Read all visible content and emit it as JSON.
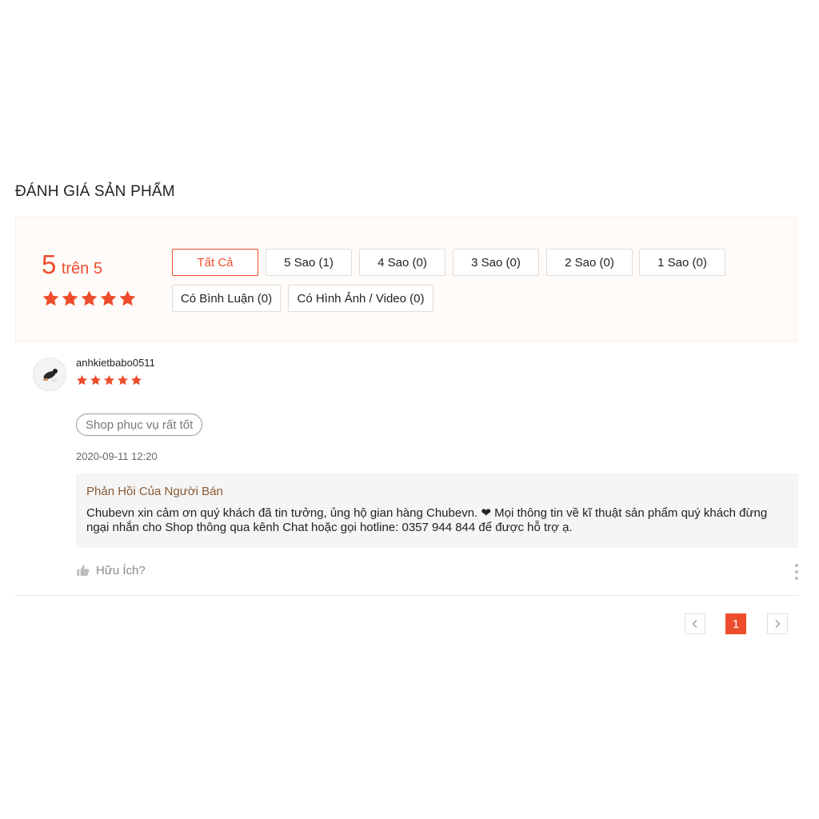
{
  "section": {
    "title": "ĐÁNH GIÁ SẢN PHẨM"
  },
  "overview": {
    "score": "5",
    "score_suffix": "trên 5",
    "stars": 5,
    "star_color": "#ee4d2d"
  },
  "filters": [
    {
      "label": "Tất Cả",
      "active": true
    },
    {
      "label": "5 Sao (1)",
      "active": false
    },
    {
      "label": "4 Sao (0)",
      "active": false
    },
    {
      "label": "3 Sao (0)",
      "active": false
    },
    {
      "label": "2 Sao (0)",
      "active": false
    },
    {
      "label": "1 Sao (0)",
      "active": false
    },
    {
      "label": "Có Bình Luận (0)",
      "active": false
    },
    {
      "label": "Có Hình Ảnh / Video (0)",
      "active": false
    }
  ],
  "review": {
    "username": "anhkietbabo0511",
    "rating": 5,
    "tag": "Shop phục vụ rất tốt",
    "timestamp": "2020-09-11 12:20",
    "seller_reply": {
      "title": "Phản Hồi Của Người Bán",
      "text_line1": "Chubevn xin cảm ơn quý khách đã tin tưởng, ủng hộ gian hàng Chubevn. ❤ Mọi thông tin về kĩ thuật sản phẩm quý khách đừng",
      "text_line2": "ngại nhắn cho Shop thông qua kênh Chat hoặc gọi hotline: 0357 944 844 để được hỗ trợ ạ."
    },
    "helpful_label": "Hữu Ích?"
  },
  "pagination": {
    "current_page": "1"
  },
  "colors": {
    "accent": "#ee4d2d",
    "overview_bg": "#fffbf8",
    "reply_bg": "#f5f5f5",
    "reply_title": "#8a5a32"
  }
}
